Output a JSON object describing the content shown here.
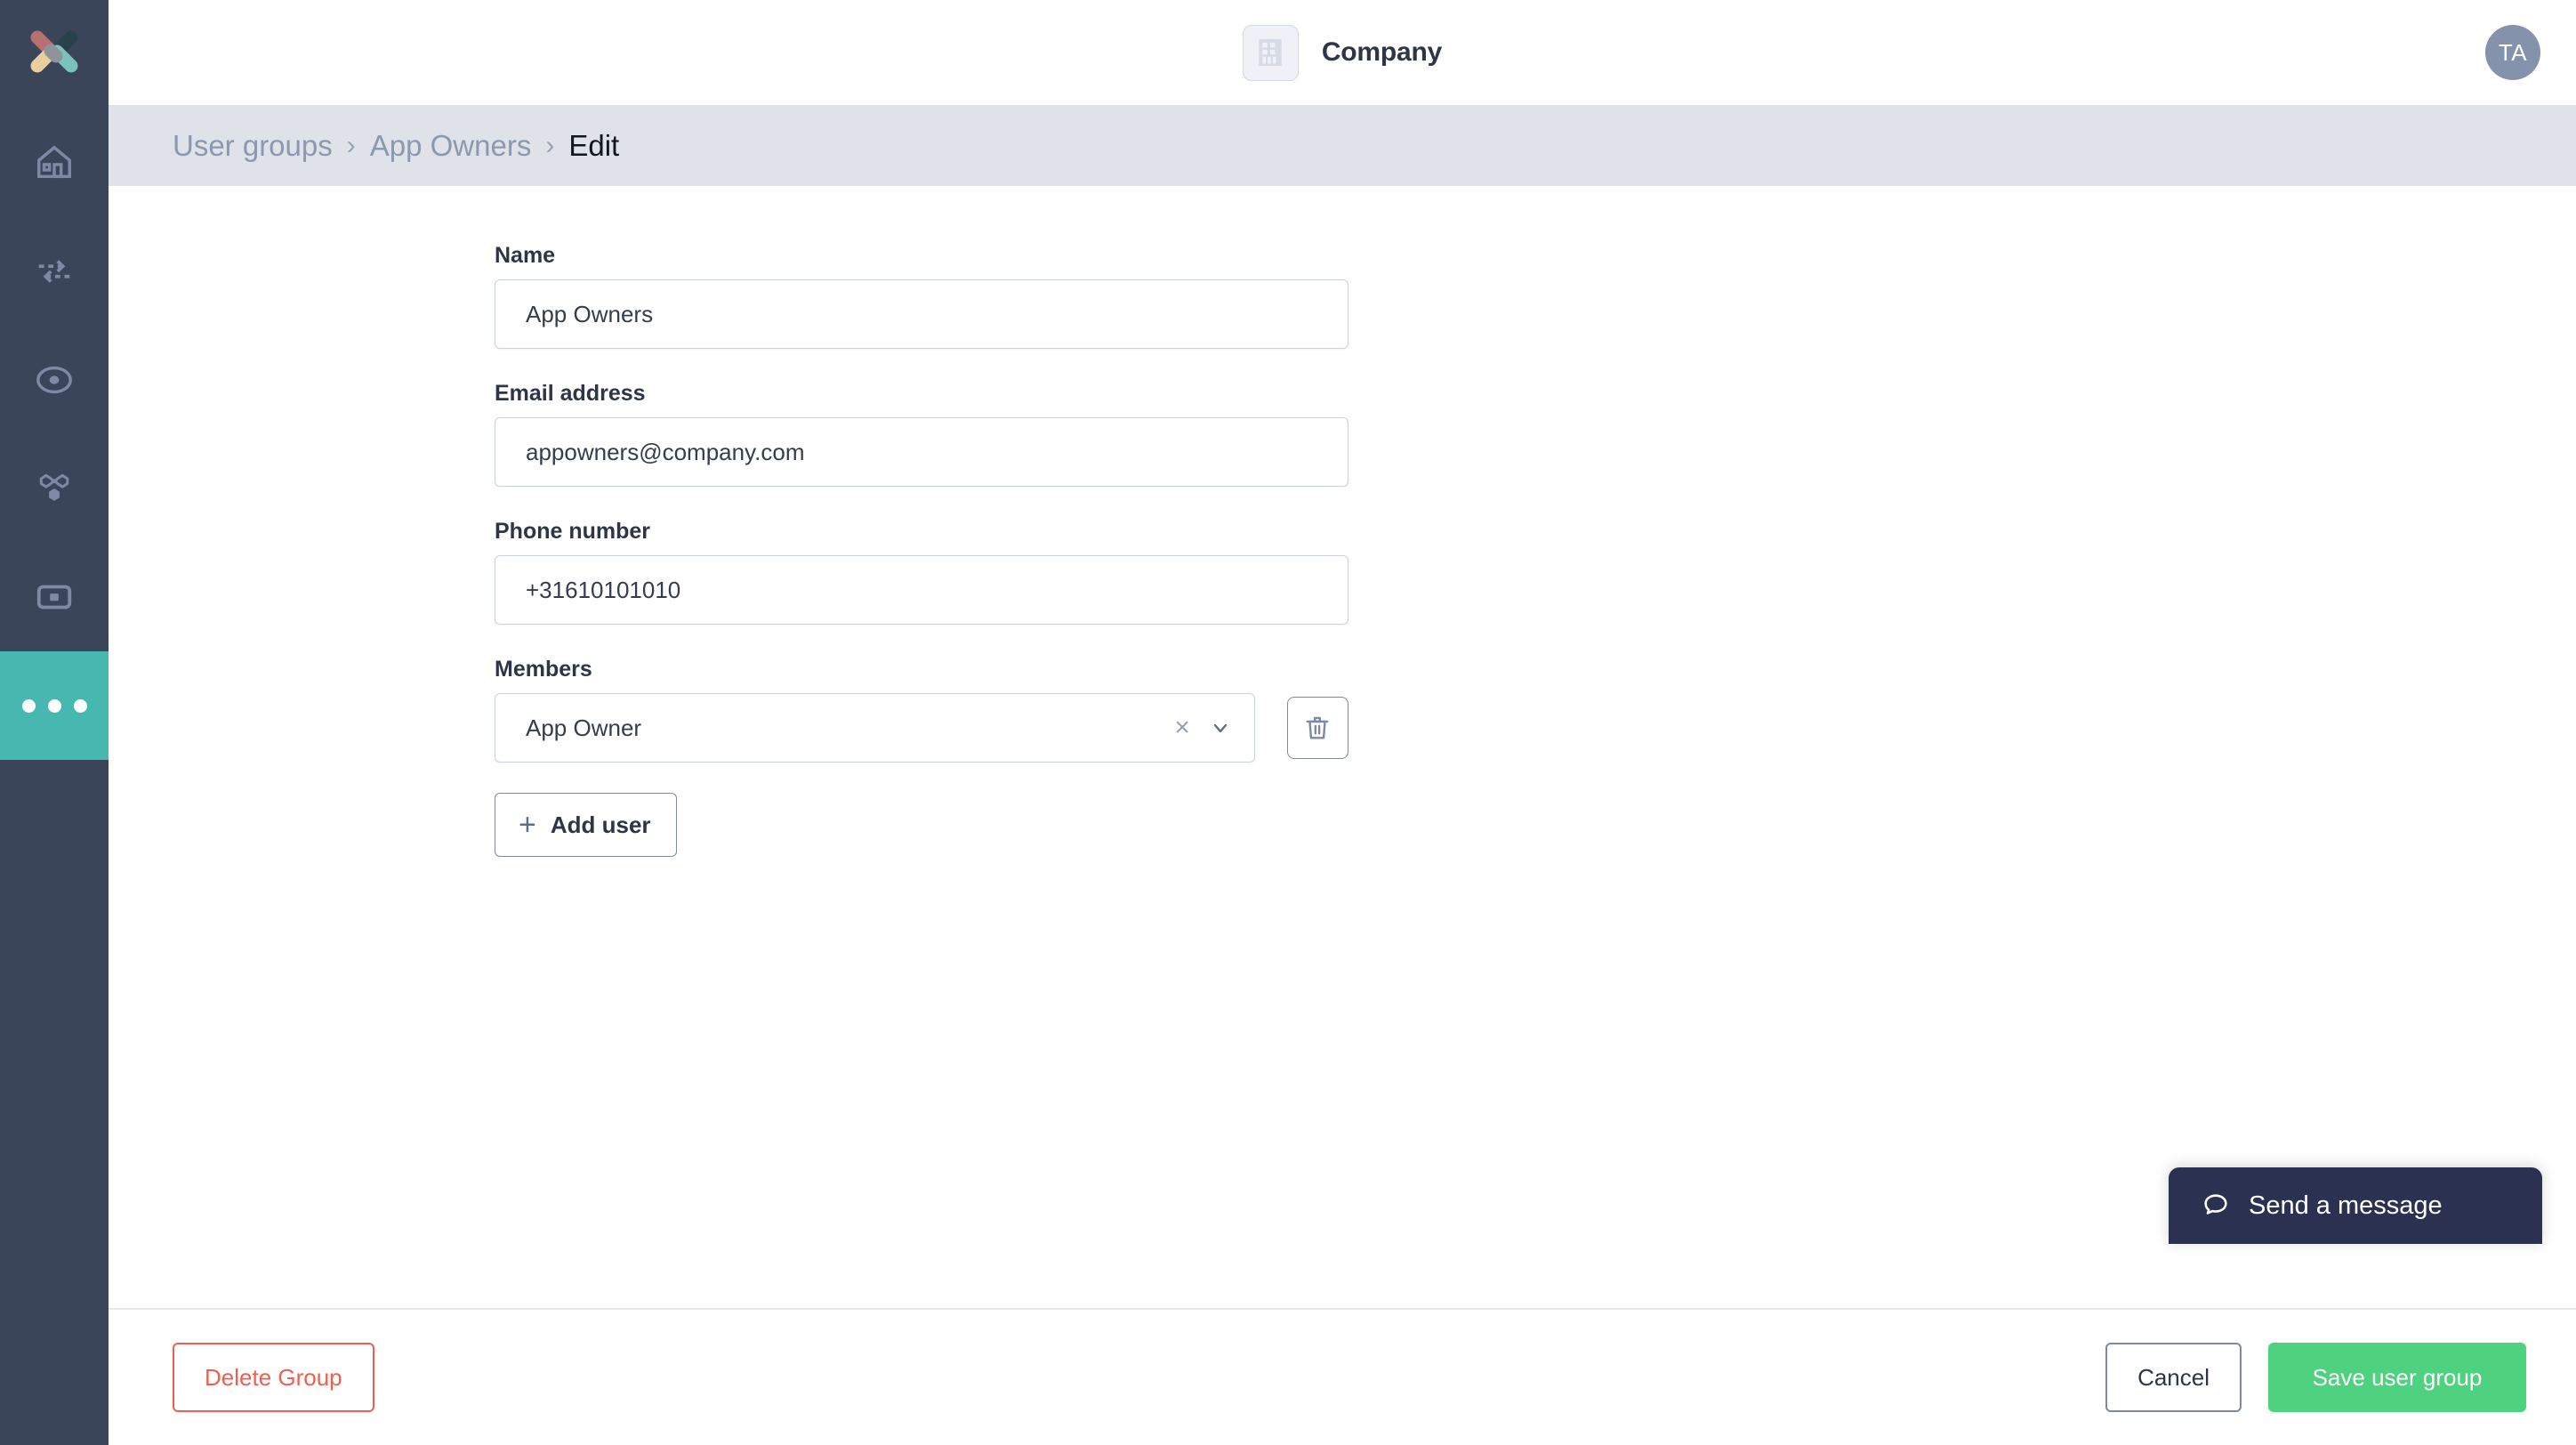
{
  "sidebar": {
    "logo_name": "crossed-bars-logo",
    "items": [
      {
        "name": "home",
        "icon": "home-icon"
      },
      {
        "name": "transfers",
        "icon": "exchange-arrows-icon"
      },
      {
        "name": "target",
        "icon": "target-icon"
      },
      {
        "name": "network",
        "icon": "network-nodes-icon"
      },
      {
        "name": "devices",
        "icon": "device-frame-icon"
      },
      {
        "name": "more",
        "icon": "more-dots-icon",
        "active": true
      }
    ]
  },
  "header": {
    "company_icon": "building-icon",
    "company_name": "Company",
    "avatar_initials": "TA"
  },
  "breadcrumb": {
    "separator": "›",
    "items": [
      {
        "label": "User groups",
        "current": false
      },
      {
        "label": "App Owners",
        "current": false
      },
      {
        "label": "Edit",
        "current": true
      }
    ]
  },
  "form": {
    "name": {
      "label": "Name",
      "value": "App Owners",
      "placeholder": "Name"
    },
    "email": {
      "label": "Email address",
      "value": "appowners@company.com",
      "placeholder": "Email address"
    },
    "phone": {
      "label": "Phone number",
      "value": "+31610101010",
      "placeholder": "Phone number"
    },
    "members": {
      "label": "Members",
      "value": "App Owner",
      "clear_glyph": "×",
      "chevron_icon": "chevron-down-icon",
      "remove_icon": "trash-icon"
    },
    "add_user_label": "Add user",
    "add_user_plus": "+"
  },
  "footer": {
    "delete_label": "Delete Group",
    "cancel_label": "Cancel",
    "save_label": "Save user group"
  },
  "chat": {
    "icon": "speech-bubble-icon",
    "label": "Send a message"
  },
  "colors": {
    "sidebar_bg": "#3b455a",
    "active_teal": "#47b8b0",
    "breadcrumb_bg": "#dfe3e9",
    "primary_green": "#4ed27f",
    "danger_red": "#ef5f51",
    "chat_navy": "#2b3150",
    "avatar_grey": "#8592ac"
  }
}
